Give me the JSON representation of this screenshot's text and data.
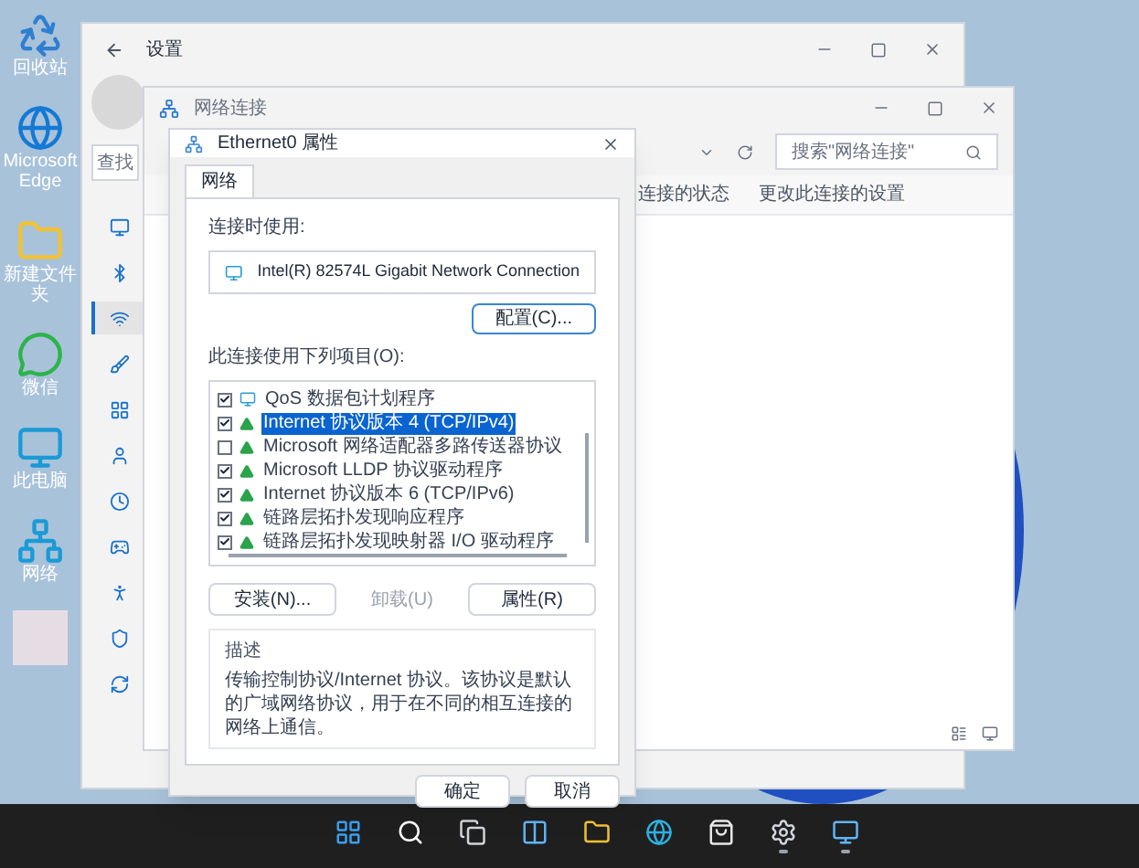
{
  "desktop_icons": [
    {
      "label": "回收站"
    },
    {
      "label": "Microsoft Edge"
    },
    {
      "label": "新建文件夹"
    },
    {
      "label": "微信"
    },
    {
      "label": "此电脑"
    },
    {
      "label": "网络"
    }
  ],
  "settings_window": {
    "title": "设置",
    "search": {
      "placeholder": "查找"
    },
    "sidebar": [
      {
        "selected": false
      },
      {
        "selected": false
      },
      {
        "selected": true
      },
      {
        "selected": false
      },
      {
        "selected": false
      },
      {
        "selected": false
      },
      {
        "selected": false
      },
      {
        "selected": false
      },
      {
        "selected": false
      },
      {
        "selected": false
      },
      {
        "selected": false
      }
    ]
  },
  "network_window": {
    "title": "网络连接",
    "search": {
      "placeholder": "搜索\"网络连接\""
    },
    "toolbar": [
      "连接的状态",
      "更改此连接的设置"
    ]
  },
  "dialog": {
    "title": "Ethernet0 属性",
    "tabs": [
      {
        "label": "网络",
        "selected": true
      }
    ],
    "connect_using_label": "连接时使用:",
    "adapter": "Intel(R) 82574L Gigabit Network Connection",
    "configure_button": "配置(C)...",
    "items_label": "此连接使用下列项目(O):",
    "items": [
      {
        "kind": "service",
        "label": "QoS 数据包计划程序",
        "checked": true,
        "selected": false
      },
      {
        "kind": "protocol",
        "label": "Internet 协议版本 4 (TCP/IPv4)",
        "checked": true,
        "selected": true
      },
      {
        "kind": "protocol",
        "label": "Microsoft 网络适配器多路传送器协议",
        "checked": false,
        "selected": false
      },
      {
        "kind": "protocol",
        "label": "Microsoft LLDP 协议驱动程序",
        "checked": true,
        "selected": false
      },
      {
        "kind": "protocol",
        "label": "Internet 协议版本 6 (TCP/IPv6)",
        "checked": true,
        "selected": false
      },
      {
        "kind": "protocol",
        "label": "链路层拓扑发现响应程序",
        "checked": true,
        "selected": false
      },
      {
        "kind": "protocol",
        "label": "链路层拓扑发现映射器 I/O 驱动程序",
        "checked": true,
        "selected": false
      }
    ],
    "item_buttons": [
      {
        "label": "安装(N)...",
        "disabled": false
      },
      {
        "label": "卸载(U)",
        "disabled": true
      },
      {
        "label": "属性(R)",
        "disabled": false
      }
    ],
    "description": {
      "title": "描述",
      "text": "传输控制协议/Internet 协议。该协议是默认的广域网络协议，用于在不同的相互连接的网络上通信。"
    },
    "buttons": [
      "确定",
      "取消"
    ]
  },
  "taskbar": [
    {
      "running": false
    },
    {
      "running": false
    },
    {
      "running": false
    },
    {
      "running": false
    },
    {
      "running": false
    },
    {
      "running": false
    },
    {
      "running": false
    },
    {
      "running": true
    },
    {
      "running": true
    }
  ]
}
